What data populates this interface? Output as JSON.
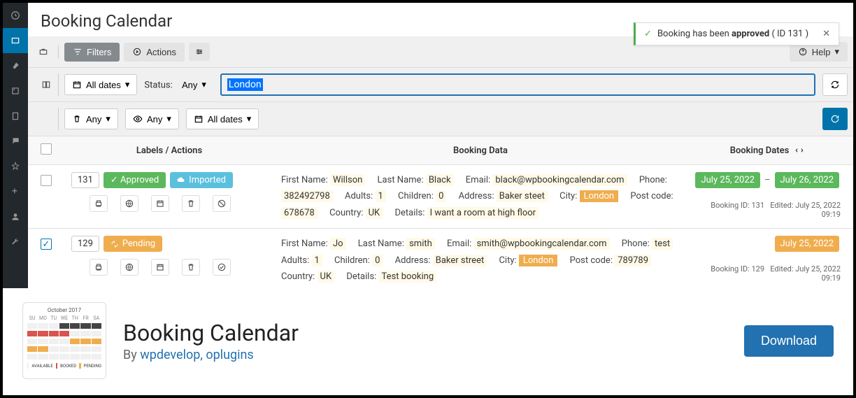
{
  "page_title": "Booking Calendar",
  "notice": {
    "text_before": "Booking has been ",
    "text_bold": "approved",
    "text_after": " ( ID   131 )"
  },
  "tabs": {
    "filters": "Filters",
    "actions": "Actions",
    "help": "Help"
  },
  "filters": {
    "all_dates": "All dates",
    "status_label": "Status:",
    "status_value": "Any",
    "search_value": "London",
    "any1": "Any",
    "any2": "Any",
    "all_dates2": "All dates"
  },
  "table_head": {
    "labels": "Labels / Actions",
    "data": "Booking Data",
    "dates": "Booking Dates"
  },
  "status_labels": {
    "approved": "Approved",
    "pending": "Pending",
    "imported": "Imported"
  },
  "field_labels": {
    "first_name": "First Name",
    "last_name": "Last Name",
    "email": "Email",
    "phone": "Phone",
    "adults": "Adults",
    "children": "Children",
    "address": "Address",
    "city": "City",
    "post_code": "Post code",
    "country": "Country",
    "details": "Details"
  },
  "rows": [
    {
      "id": "131",
      "checked": false,
      "status": "approved",
      "imported": true,
      "first_name": "Willson",
      "last_name": "Black",
      "email": "black@wpbookingcalendar.com",
      "phone": "382492798",
      "adults": "1",
      "children": "0",
      "address": "Baker steet",
      "city": "London",
      "post_code": "678678",
      "country": "UK",
      "details": "I want a room at high floor",
      "dates": [
        "July 25, 2022",
        "July 26, 2022"
      ],
      "meta_id": "Booking ID: 131",
      "meta_edit": "Edited: July 25, 2022 09:19"
    },
    {
      "id": "129",
      "checked": true,
      "status": "pending",
      "imported": false,
      "first_name": "Jo",
      "last_name": "smith",
      "email": "smith@wpbookingcalendar.com",
      "phone": "test",
      "adults": "1",
      "children": "0",
      "address": "Baker street",
      "city": "London",
      "post_code": "789789",
      "country": "UK",
      "details": "Test booking",
      "dates": [
        "July 25, 2022"
      ],
      "meta_id": "Booking ID: 129",
      "meta_edit": "Edited: July 25, 2022 09:19"
    }
  ],
  "footer": {
    "title": "Booking Calendar",
    "by_prefix": "By ",
    "author": "wpdevelop, oplugins",
    "download": "Download",
    "thumb_month": "October 2017",
    "thumb_days": [
      "SU",
      "MO",
      "TU",
      "WE",
      "TH",
      "FR",
      "SA"
    ],
    "legend": [
      "AVAILABLE",
      "BOOKED",
      "PENDING"
    ]
  }
}
